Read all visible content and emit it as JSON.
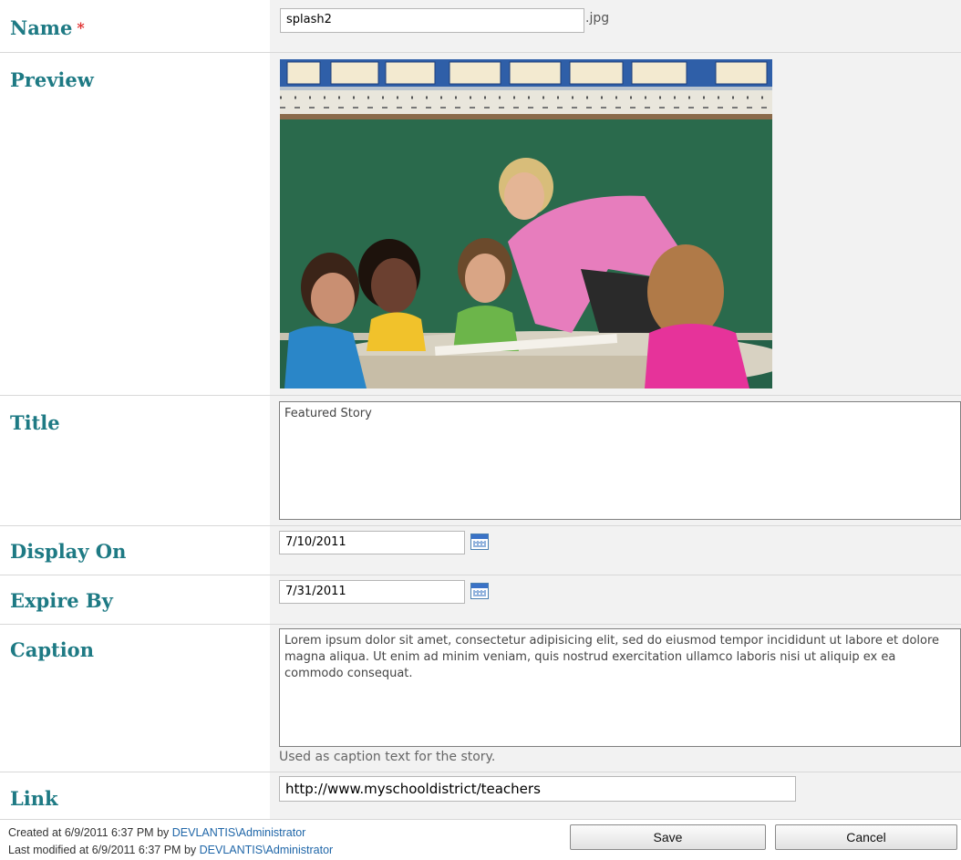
{
  "fields": {
    "name": {
      "label": "Name",
      "required_mark": "*",
      "value": "splash2",
      "suffix": ".jpg"
    },
    "preview": {
      "label": "Preview",
      "image_alt": "Teacher helping students at desks in a classroom"
    },
    "title": {
      "label": "Title",
      "value": "Featured Story"
    },
    "display_on": {
      "label": "Display On",
      "value": "7/10/2011"
    },
    "expire_by": {
      "label": "Expire By",
      "value": "7/31/2011"
    },
    "caption": {
      "label": "Caption",
      "value": "Lorem ipsum dolor sit amet, consectetur adipisicing elit, sed do eiusmod tempor incididunt ut labore et dolore magna aliqua. Ut enim ad minim veniam, quis nostrud exercitation ullamco laboris nisi ut aliquip ex ea commodo consequat.",
      "hint": "Used as caption text for the story."
    },
    "link": {
      "label": "Link",
      "value": "http://www.myschooldistrict/teachers"
    }
  },
  "footer": {
    "created_prefix": "Created at 6/9/2011 6:37 PM by ",
    "created_user": "DEVLANTIS\\Administrator",
    "modified_prefix": "Last modified at 6/9/2011 6:37 PM by ",
    "modified_user": "DEVLANTIS\\Administrator"
  },
  "buttons": {
    "save": "Save",
    "cancel": "Cancel"
  },
  "icons": {
    "display_on_picker": "calendar-icon",
    "expire_by_picker": "calendar-icon"
  },
  "colors": {
    "label": "#1e7a84",
    "required": "#e03030",
    "user_link": "#1f66a8"
  }
}
